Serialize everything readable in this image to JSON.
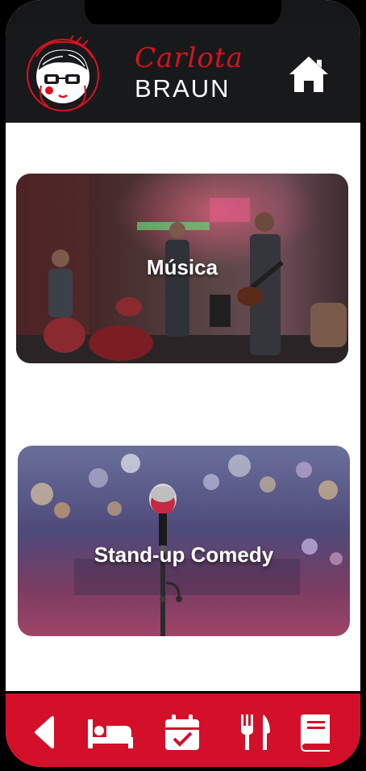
{
  "header": {
    "brand_script": "Carlota",
    "brand_block": "BRAUN",
    "logo_icon": "carlota-face-logo",
    "home_icon": "home-icon"
  },
  "cards": [
    {
      "label": "Música",
      "image": "live-band-photo"
    },
    {
      "label": "Stand-up Comedy",
      "image": "microphone-stage-photo"
    }
  ],
  "bottom_nav": {
    "items": [
      "back-icon",
      "bed-icon",
      "calendar-check-icon",
      "utensils-icon",
      "book-icon"
    ]
  },
  "colors": {
    "header_bg": "#17191b",
    "accent_red": "#d40f29",
    "brand_red": "#d8121f",
    "content_bg": "#ffffff"
  }
}
